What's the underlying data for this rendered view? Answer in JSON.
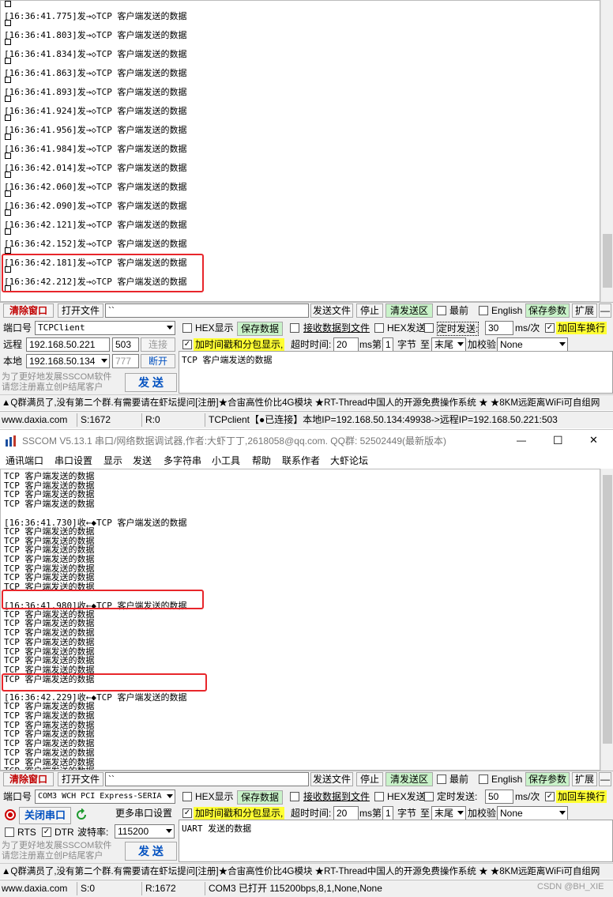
{
  "top": {
    "log_lines": [
      "[16:36:41.775]发→◇TCP 客户端发送的数据",
      "[16:36:41.803]发→◇TCP 客户端发送的数据",
      "[16:36:41.834]发→◇TCP 客户端发送的数据",
      "[16:36:41.863]发→◇TCP 客户端发送的数据",
      "[16:36:41.893]发→◇TCP 客户端发送的数据",
      "[16:36:41.924]发→◇TCP 客户端发送的数据",
      "[16:36:41.956]发→◇TCP 客户端发送的数据",
      "[16:36:41.984]发→◇TCP 客户端发送的数据",
      "[16:36:42.014]发→◇TCP 客户端发送的数据",
      "[16:36:42.060]发→◇TCP 客户端发送的数据",
      "[16:36:42.090]发→◇TCP 客户端发送的数据",
      "[16:36:42.121]发→◇TCP 客户端发送的数据",
      "[16:36:42.152]发→◇TCP 客户端发送的数据",
      "[16:36:42.181]发→◇TCP 客户端发送的数据",
      "[16:36:42.212]发→◇TCP 客户端发送的数据"
    ],
    "toolbar": {
      "clear": "清除窗口",
      "open_file": "打开文件",
      "file_path": "``",
      "send_file": "发送文件",
      "stop": "停止",
      "clear_send": "清发送区",
      "topmost": "最前",
      "english": "English",
      "save_params": "保存参数",
      "expand": "扩展",
      "minus": "—"
    },
    "port_label": "端口号",
    "port_value": "TCPClient",
    "hex_display": "HEX显示",
    "save_data": "保存数据",
    "recv_to_file": "接收数据到文件",
    "hex_send": "HEX发送",
    "timed_send": "定时发送:",
    "interval": "30",
    "interval_unit": "ms/次",
    "add_crlf": "加回车换行",
    "remote_label": "远程",
    "remote_ip": "192.168.50.221",
    "remote_port": "503",
    "connect": "连接",
    "timestamp_label": "加时间戳和分包显示,",
    "timeout_label": "超时时间:",
    "timeout_value": "20",
    "timeout_unit": "ms",
    "nth_label": "第",
    "nth_value": "1",
    "byte_label": "字节",
    "to_label": "至",
    "to_value": "末尾",
    "checksum_label": "加校验",
    "checksum_value": "None",
    "local_label": "本地",
    "local_ip": "192.168.50.134",
    "local_port": "777",
    "disconnect": "断开",
    "send_text": "TCP 客户端发送的数据",
    "promo_line1": "为了更好地发展SSCOM软件",
    "promo_line2": "请您注册嘉立创P结尾客户",
    "send_button": "发 送",
    "ticker": "▲Q群满员了,没有第二个群.有需要请在虾坛提问[注册]★合宙高性价比4G模块 ★RT-Thread中国人的开源免费操作系统 ★ ★8KM远距离WiFi可自组网",
    "status": {
      "site": "www.daxia.com",
      "sent": "S:1672",
      "recv": "R:0",
      "info": "TCPclient【●已连接】本地IP=192.168.50.134:49938->远程IP=192.168.50.221:503"
    }
  },
  "bottom": {
    "title": "SSCOM V5.13.1 串口/网络数据调试器,作者:大虾丁丁,2618058@qq.com. QQ群: 52502449(最新版本)",
    "window_buttons": {
      "minimize": "—",
      "maximize": "☐",
      "close": "✕"
    },
    "menu": [
      "通讯端口",
      "串口设置",
      "显示",
      "发送",
      "多字符串",
      "小工具",
      "帮助",
      "联系作者",
      "大虾论坛"
    ],
    "log_blocks": [
      {
        "header": "",
        "lines": [
          "TCP 客户端发送的数据",
          "TCP 客户端发送的数据",
          "TCP 客户端发送的数据",
          "TCP 客户端发送的数据"
        ]
      },
      {
        "header": "[16:36:41.730]收←◆TCP 客户端发送的数据",
        "lines": [
          "TCP 客户端发送的数据",
          "TCP 客户端发送的数据",
          "TCP 客户端发送的数据",
          "TCP 客户端发送的数据",
          "TCP 客户端发送的数据",
          "TCP 客户端发送的数据",
          "TCP 客户端发送的数据"
        ]
      },
      {
        "header": "[16:36:41.980]收←◆TCP 客户端发送的数据",
        "lines": [
          "TCP 客户端发送的数据",
          "TCP 客户端发送的数据",
          "TCP 客户端发送的数据",
          "TCP 客户端发送的数据",
          "TCP 客户端发送的数据",
          "TCP 客户端发送的数据",
          "TCP 客户端发送的数据",
          "TCP 客户端发送的数据"
        ]
      },
      {
        "header": "[16:36:42.229]收←◆TCP 客户端发送的数据",
        "lines": [
          "TCP 客户端发送的数据",
          "TCP 客户端发送的数据",
          "TCP 客户端发送的数据",
          "TCP 客户端发送的数据",
          "TCP 客户端发送的数据",
          "TCP 客户端发送的数据",
          "TCP 客户端发送的数据",
          "TCP 客户端发送的数据"
        ]
      }
    ],
    "toolbar": {
      "clear": "清除窗口",
      "open_file": "打开文件",
      "file_path": "``",
      "send_file": "发送文件",
      "stop": "停止",
      "clear_send": "清发送区",
      "topmost": "最前",
      "english": "English",
      "save_params": "保存参数",
      "expand": "扩展",
      "minus": "—"
    },
    "port_label": "端口号",
    "port_value": "COM3 WCH PCI Express-SERIA",
    "hex_display": "HEX显示",
    "save_data": "保存数据",
    "recv_to_file": "接收数据到文件",
    "hex_send": "HEX发送",
    "timed_send": "定时发送:",
    "interval": "50",
    "interval_unit": "ms/次",
    "add_crlf": "加回车换行",
    "close_port": "关闭串口",
    "more_settings": "更多串口设置",
    "timestamp_label": "加时间戳和分包显示,",
    "timeout_label": "超时时间:",
    "timeout_value": "20",
    "timeout_unit": "ms",
    "nth_label": "第",
    "nth_value": "1",
    "byte_label": "字节",
    "to_label": "至",
    "to_value": "末尾",
    "checksum_label": "加校验",
    "checksum_value": "None",
    "rts": "RTS",
    "dtr": "DTR",
    "baud_label": "波特率:",
    "baud_value": "115200",
    "send_text": "UART 发送的数据",
    "promo_line1": "为了更好地发展SSCOM软件",
    "promo_line2": "请您注册嘉立创P结尾客户",
    "send_button": "发 送",
    "ticker": "▲Q群满员了,没有第二个群.有需要请在虾坛提问[注册]★合宙高性价比4G模块 ★RT-Thread中国人的开源免费操作系统 ★ ★8KM远距离WiFi可自组网",
    "status": {
      "site": "www.daxia.com",
      "sent": "S:0",
      "recv": "R:1672",
      "info": "COM3 已打开  115200bps,8,1,None,None"
    },
    "watermark": "CSDN @BH_XIE"
  },
  "colors": {
    "highlight_red": "#e8262b",
    "button_green": "#c9f2c9",
    "button_yellow": "#ffff33",
    "clear_red": "#c00000"
  }
}
